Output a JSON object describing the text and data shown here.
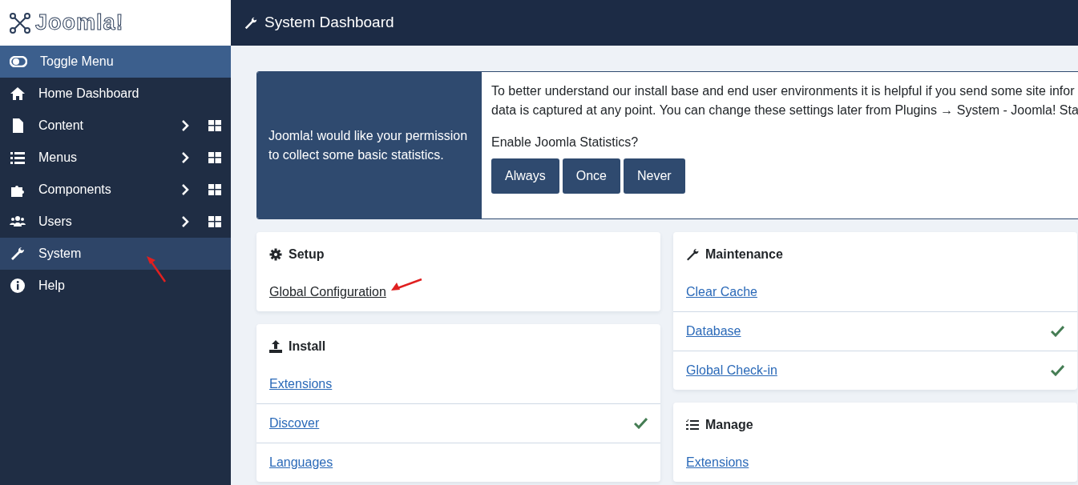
{
  "logo": {
    "text": "Joomla!"
  },
  "header": {
    "title": "System Dashboard"
  },
  "sidebar": {
    "toggle": "Toggle Menu",
    "items": [
      {
        "label": "Home Dashboard",
        "has_submenu": false,
        "selected": false
      },
      {
        "label": "Content",
        "has_submenu": true,
        "selected": false
      },
      {
        "label": "Menus",
        "has_submenu": true,
        "selected": false
      },
      {
        "label": "Components",
        "has_submenu": true,
        "selected": false
      },
      {
        "label": "Users",
        "has_submenu": true,
        "selected": false
      },
      {
        "label": "System",
        "has_submenu": false,
        "selected": true
      },
      {
        "label": "Help",
        "has_submenu": false,
        "selected": false
      }
    ]
  },
  "stats_banner": {
    "message": "Joomla! would like your permission to collect some basic statistics.",
    "description": [
      "To better understand our install base and end user environments it is helpful if you send some site infor",
      "data is captured at any point. You can change these settings later from Plugins → System - Joomla! Sta"
    ],
    "question": "Enable Joomla Statistics?",
    "buttons": [
      "Always",
      "Once",
      "Never"
    ]
  },
  "columns": [
    [
      {
        "title": "Setup",
        "links": [
          {
            "label": "Global Configuration",
            "checked": false
          }
        ]
      },
      {
        "title": "Install",
        "links": [
          {
            "label": "Extensions",
            "checked": false
          },
          {
            "label": "Discover",
            "checked": true
          },
          {
            "label": "Languages",
            "checked": false
          }
        ]
      }
    ],
    [
      {
        "title": "Maintenance",
        "links": [
          {
            "label": "Clear Cache",
            "checked": false
          },
          {
            "label": "Database",
            "checked": true
          },
          {
            "label": "Global Check-in",
            "checked": true
          }
        ]
      },
      {
        "title": "Manage",
        "links": [
          {
            "label": "Extensions",
            "checked": false
          }
        ]
      }
    ]
  ]
}
